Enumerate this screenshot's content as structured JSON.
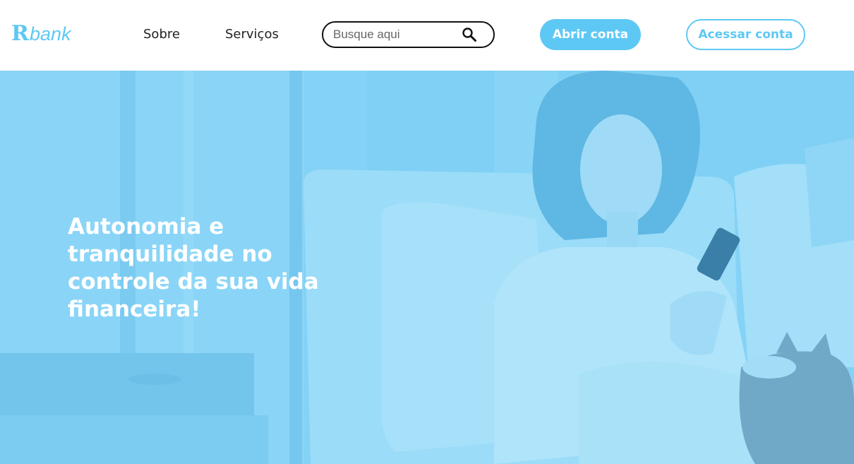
{
  "header": {
    "logo": {
      "mark": "R",
      "word": "bank"
    },
    "nav": [
      {
        "label": "Sobre"
      },
      {
        "label": "Serviços"
      }
    ],
    "search": {
      "placeholder": "Busque aqui",
      "icon": "search-icon"
    },
    "actions": {
      "open_account": "Abrir conta",
      "access_account": "Acessar conta"
    }
  },
  "hero": {
    "title": "Autonomia e tranquilidade no controle da sua vida financeira!",
    "overlay_color": "#86d3f7"
  },
  "colors": {
    "accent": "#5ec8f4",
    "text": "#222222",
    "white": "#ffffff"
  }
}
